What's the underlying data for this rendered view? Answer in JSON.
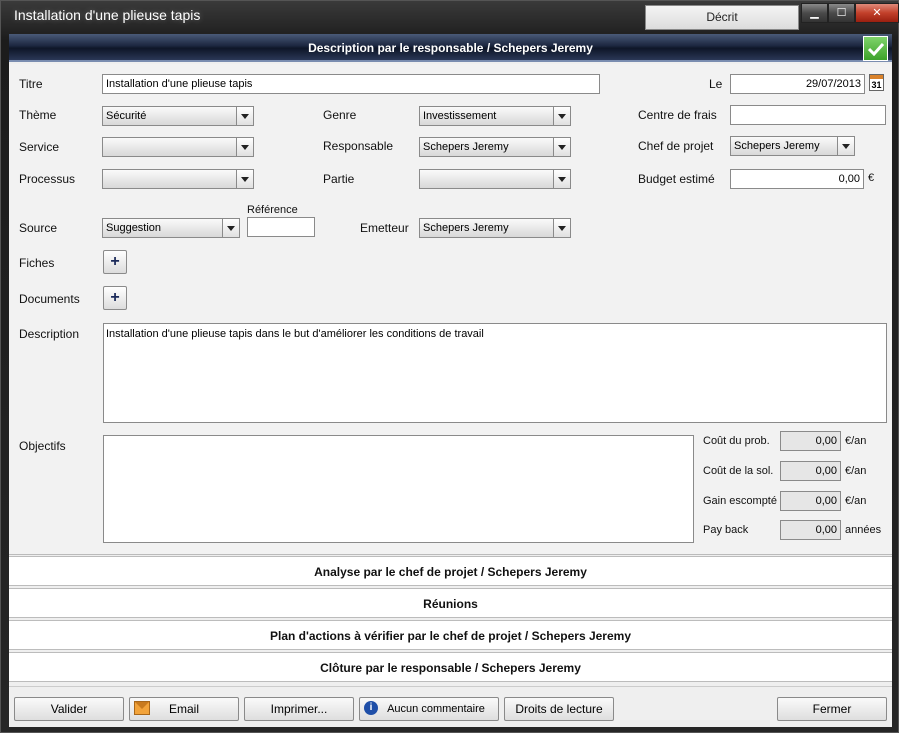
{
  "window": {
    "title": "Installation d'une plieuse tapis",
    "status": "Décrit",
    "controls": {
      "minimize": "▁",
      "maximize": "☐",
      "close": "✕"
    }
  },
  "section": {
    "header": "Description par le responsable / Schepers Jeremy"
  },
  "form": {
    "titre": {
      "label": "Titre",
      "value": "Installation d'une plieuse tapis"
    },
    "le": {
      "label": "Le",
      "value": "29/07/2013",
      "calendar_day": "31"
    },
    "theme": {
      "label": "Thème",
      "value": "Sécurité"
    },
    "genre": {
      "label": "Genre",
      "value": "Investissement"
    },
    "centre_de_frais": {
      "label": "Centre de frais",
      "value": ""
    },
    "service": {
      "label": "Service",
      "value": ""
    },
    "responsable": {
      "label": "Responsable",
      "value": "Schepers Jeremy"
    },
    "chef_de_projet": {
      "label": "Chef de projet",
      "value": "Schepers Jeremy"
    },
    "processus": {
      "label": "Processus",
      "value": ""
    },
    "partie": {
      "label": "Partie",
      "value": ""
    },
    "budget_estime": {
      "label": "Budget estimé",
      "value": "0,00",
      "unit": "€"
    },
    "source": {
      "label": "Source",
      "value": "Suggestion"
    },
    "reference": {
      "label": "Référence",
      "value": ""
    },
    "emetteur": {
      "label": "Emetteur",
      "value": "Schepers Jeremy"
    },
    "fiches": {
      "label": "Fiches",
      "add": "+"
    },
    "documents": {
      "label": "Documents",
      "add": "+"
    },
    "description": {
      "label": "Description",
      "value": "Installation d'une plieuse tapis dans le but d'améliorer les conditions de travail"
    },
    "objectifs": {
      "label": "Objectifs",
      "value": ""
    },
    "cout_prob": {
      "label": "Coût du prob.",
      "value": "0,00",
      "unit": "€/an"
    },
    "cout_sol": {
      "label": "Coût de la sol.",
      "value": "0,00",
      "unit": "€/an"
    },
    "gain": {
      "label": "Gain escompté",
      "value": "0,00",
      "unit": "€/an"
    },
    "payback": {
      "label": "Pay back",
      "value": "0,00",
      "unit": "années"
    }
  },
  "sections": [
    "Analyse par le chef de projet / Schepers Jeremy",
    "Réunions",
    "Plan d'actions à vérifier par le chef de projet / Schepers Jeremy",
    "Clôture par le responsable / Schepers Jeremy"
  ],
  "footer": {
    "valider": "Valider",
    "email": "Email",
    "imprimer": "Imprimer...",
    "commentaire": "Aucun commentaire",
    "droits": "Droits de lecture",
    "fermer": "Fermer"
  },
  "icons": {
    "check": "check-icon",
    "calendar": "calendar-icon",
    "mail": "mail-icon",
    "info": "info-icon"
  }
}
